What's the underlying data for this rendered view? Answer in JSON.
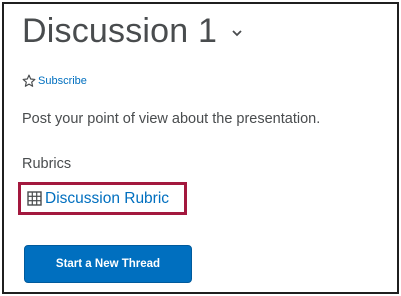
{
  "topic": {
    "title": "Discussion 1",
    "menu_icon": "chevron-down-icon"
  },
  "subscribe": {
    "icon": "star-outline-icon",
    "label": "Subscribe"
  },
  "description": "Post your point of view about the presentation.",
  "rubrics": {
    "heading": "Rubrics",
    "items": [
      {
        "icon": "grid-icon",
        "label": "Discussion Rubric"
      }
    ]
  },
  "actions": {
    "start_thread_label": "Start a New Thread"
  },
  "colors": {
    "text": "#494c4e",
    "link": "#006fbf",
    "button": "#006fbf",
    "highlight_border": "#a3183e"
  }
}
